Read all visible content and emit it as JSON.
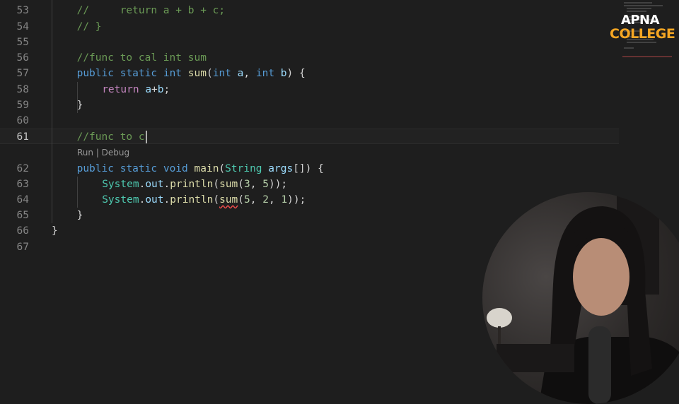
{
  "editor": {
    "lines": [
      {
        "num": "53",
        "tokens": [
          {
            "t": "//     return a + b + c;",
            "c": "cm"
          }
        ]
      },
      {
        "num": "54",
        "tokens": [
          {
            "t": "// }",
            "c": "cm"
          }
        ]
      },
      {
        "num": "55",
        "tokens": []
      },
      {
        "num": "56",
        "tokens": [
          {
            "t": "//func to cal int sum",
            "c": "cm"
          }
        ]
      },
      {
        "num": "57",
        "tokens": [
          {
            "t": "public",
            "c": "kw"
          },
          {
            "t": " ",
            "c": "pl"
          },
          {
            "t": "static",
            "c": "kw"
          },
          {
            "t": " ",
            "c": "pl"
          },
          {
            "t": "int",
            "c": "kw"
          },
          {
            "t": " ",
            "c": "pl"
          },
          {
            "t": "sum",
            "c": "fn"
          },
          {
            "t": "(",
            "c": "pl"
          },
          {
            "t": "int",
            "c": "kw"
          },
          {
            "t": " ",
            "c": "pl"
          },
          {
            "t": "a",
            "c": "va"
          },
          {
            "t": ", ",
            "c": "pl"
          },
          {
            "t": "int",
            "c": "kw"
          },
          {
            "t": " ",
            "c": "pl"
          },
          {
            "t": "b",
            "c": "va"
          },
          {
            "t": ") {",
            "c": "pl"
          }
        ]
      },
      {
        "num": "58",
        "tokens": [
          {
            "t": "return",
            "c": "ctl"
          },
          {
            "t": " ",
            "c": "pl"
          },
          {
            "t": "a",
            "c": "va"
          },
          {
            "t": "+",
            "c": "pl"
          },
          {
            "t": "b",
            "c": "va"
          },
          {
            "t": ";",
            "c": "pl"
          }
        ]
      },
      {
        "num": "59",
        "tokens": [
          {
            "t": "}",
            "c": "pl"
          }
        ]
      },
      {
        "num": "60",
        "tokens": []
      },
      {
        "num": "61",
        "tokens": [
          {
            "t": "//func to c",
            "c": "cm"
          }
        ],
        "current": true
      },
      {
        "num": "62",
        "tokens": [
          {
            "t": "public",
            "c": "kw"
          },
          {
            "t": " ",
            "c": "pl"
          },
          {
            "t": "static",
            "c": "kw"
          },
          {
            "t": " ",
            "c": "pl"
          },
          {
            "t": "void",
            "c": "kw"
          },
          {
            "t": " ",
            "c": "pl"
          },
          {
            "t": "main",
            "c": "fn"
          },
          {
            "t": "(",
            "c": "pl"
          },
          {
            "t": "String",
            "c": "ty"
          },
          {
            "t": " ",
            "c": "pl"
          },
          {
            "t": "args",
            "c": "va"
          },
          {
            "t": "[]) {",
            "c": "pl"
          }
        ]
      },
      {
        "num": "63",
        "tokens": [
          {
            "t": "System",
            "c": "ty"
          },
          {
            "t": ".",
            "c": "pl"
          },
          {
            "t": "out",
            "c": "va"
          },
          {
            "t": ".",
            "c": "pl"
          },
          {
            "t": "println",
            "c": "fn"
          },
          {
            "t": "(",
            "c": "pl"
          },
          {
            "t": "sum",
            "c": "fn"
          },
          {
            "t": "(",
            "c": "pl"
          },
          {
            "t": "3",
            "c": "nu"
          },
          {
            "t": ", ",
            "c": "pl"
          },
          {
            "t": "5",
            "c": "nu"
          },
          {
            "t": "));",
            "c": "pl"
          }
        ]
      },
      {
        "num": "64",
        "tokens": [
          {
            "t": "System",
            "c": "ty"
          },
          {
            "t": ".",
            "c": "pl"
          },
          {
            "t": "out",
            "c": "va"
          },
          {
            "t": ".",
            "c": "pl"
          },
          {
            "t": "println",
            "c": "fn"
          },
          {
            "t": "(",
            "c": "pl"
          },
          {
            "t": "sum",
            "c": "fn",
            "err": true
          },
          {
            "t": "(",
            "c": "pl"
          },
          {
            "t": "5",
            "c": "nu"
          },
          {
            "t": ", ",
            "c": "pl"
          },
          {
            "t": "2",
            "c": "nu"
          },
          {
            "t": ", ",
            "c": "pl"
          },
          {
            "t": "1",
            "c": "nu"
          },
          {
            "t": "));",
            "c": "pl"
          }
        ]
      },
      {
        "num": "65",
        "tokens": [
          {
            "t": "}",
            "c": "pl"
          }
        ]
      },
      {
        "num": "66",
        "tokens": [
          {
            "t": "}",
            "c": "pl"
          }
        ]
      },
      {
        "num": "67",
        "tokens": []
      }
    ],
    "codelens": "Run | Debug"
  },
  "branding": {
    "line1": "APNA",
    "line2": "COLLEGE"
  },
  "colors": {
    "background": "#1e1e1e",
    "comment": "#6a9955",
    "keyword": "#569cd6",
    "type": "#4ec9b0",
    "function": "#dcdcaa",
    "variable": "#9cdcfe",
    "number": "#b5cea8",
    "control": "#c586c0",
    "brand_orange": "#f5a623"
  },
  "icons": [
    "text-cursor-icon"
  ]
}
